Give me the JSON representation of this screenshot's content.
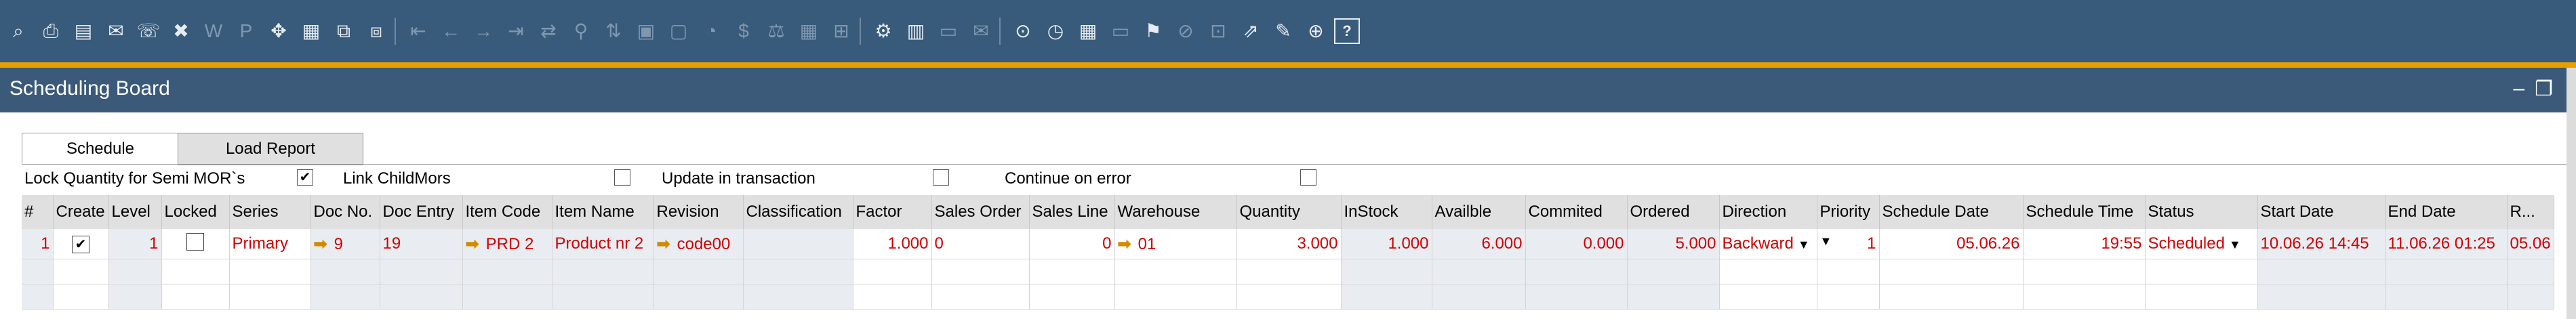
{
  "toolbar_icons": [
    "search-icon",
    "print-icon",
    "print-preview-icon",
    "email-icon",
    "fax-icon",
    "excel-icon",
    "word-icon",
    "pdf-icon",
    "move-icon",
    "form-settings-icon",
    "copy-icon",
    "paste-icon",
    "first-record-icon",
    "previous-record-icon",
    "next-record-icon",
    "last-record-icon",
    "refresh-icon",
    "filter-icon",
    "sort-icon",
    "base-document-icon",
    "target-document-icon",
    "gross-profit-icon",
    "payment-means-icon",
    "exchange-rates-icon",
    "calculator-icon",
    "user-fields-icon",
    "settings-icon",
    "layout-icon",
    "messages-icon",
    "alerts-icon",
    "activity-icon",
    "timer-icon",
    "calendar-icon",
    "chat-icon",
    "stamp-icon",
    "dashboard-icon",
    "widget-icon",
    "chart-icon",
    "edit-icon",
    "web-icon",
    "help-icon"
  ],
  "window": {
    "title": "Scheduling Board",
    "minimize_glyph": "–",
    "maximize_glyph": "❐"
  },
  "tabs": [
    {
      "label": "Schedule",
      "active": true
    },
    {
      "label": "Load Report",
      "active": false
    }
  ],
  "options": {
    "lock_quantity": {
      "label": "Lock Quantity for Semi MOR`s",
      "checked": true
    },
    "link_childmors": {
      "label": "Link ChildMors",
      "checked": false
    },
    "update_in_transaction": {
      "label": "Update in transaction",
      "checked": false
    },
    "continue_on_error": {
      "label": "Continue on error",
      "checked": false
    }
  },
  "grid": {
    "columns": [
      "#",
      "Create",
      "Level",
      "Locked",
      "Series",
      "Doc No.",
      "Doc Entry",
      "Item Code",
      "Item Name",
      "Revision",
      "Classification",
      "Factor",
      "Sales Order",
      "Sales Line",
      "Warehouse",
      "Quantity",
      "InStock",
      "Availble",
      "Commited",
      "Ordered",
      "Direction",
      "Priority",
      "Schedule Date",
      "Schedule Time",
      "Status",
      "Start Date",
      "End Date",
      "R..."
    ],
    "rows": [
      {
        "row_no": "1",
        "create": true,
        "level": "1",
        "locked": false,
        "series": "Primary",
        "doc_no": "9",
        "doc_entry": "19",
        "item_code": "PRD 2",
        "item_name": "Product nr 2",
        "revision": "code00",
        "classification": "",
        "factor": "1.000",
        "sales_order": "0",
        "sales_line": "0",
        "warehouse": "01",
        "quantity": "3.000",
        "instock": "1.000",
        "available": "6.000",
        "commited": "0.000",
        "ordered": "5.000",
        "direction": "Backward",
        "priority": "1",
        "schedule_date": "05.06.26",
        "schedule_time": "19:55",
        "status": "Scheduled",
        "start_date": "10.06.26 14:45",
        "end_date": "11.06.26 01:25",
        "r": "05.06"
      }
    ]
  },
  "colors": {
    "toolbar_bg": "#395b7b",
    "accent_orange": "#e8a000",
    "row_text": "#d00000",
    "link_arrow": "#d28b00"
  }
}
